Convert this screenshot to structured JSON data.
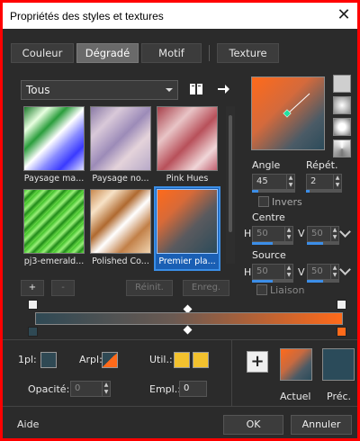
{
  "window": {
    "title": "Propriétés des styles et textures"
  },
  "tabs": [
    {
      "label": "Couleur",
      "active": false
    },
    {
      "label": "Dégradé",
      "active": true
    },
    {
      "label": "Motif",
      "active": false
    },
    {
      "label": "Texture",
      "active": false
    }
  ],
  "filter": {
    "value": "Tous"
  },
  "gradients": [
    {
      "label": "Paysage ma...",
      "selected": false
    },
    {
      "label": "Paysage no...",
      "selected": false
    },
    {
      "label": "Pink Hues",
      "selected": false
    },
    {
      "label": "pj3-emerald...",
      "selected": false
    },
    {
      "label": "Polished Co...",
      "selected": false
    },
    {
      "label": "Premier pla...",
      "selected": true
    }
  ],
  "list_buttons": {
    "add": "+",
    "remove": "-",
    "reset": "Réinit.",
    "save": "Enreg."
  },
  "params": {
    "angle_label": "Angle",
    "angle_value": "45",
    "repeat_label": "Répét.",
    "repeat_value": "2",
    "invert_label": "Invers",
    "center_label": "Centre",
    "center_h_label": "H",
    "center_h": "50",
    "center_v_label": "V",
    "center_v": "50",
    "source_label": "Source",
    "source_h_label": "H",
    "source_h": "50",
    "source_v_label": "V",
    "source_v": "50",
    "link_label": "Liaison"
  },
  "stop_props": {
    "first_label": "1pl:",
    "arpl_label": "Arpl:",
    "util_label": "Util.:",
    "opacity_label": "Opacité:",
    "opacity_value": "0",
    "location_label": "Empl.:",
    "location_value": "0"
  },
  "swatches": {
    "current_label": "Actuel",
    "previous_label": "Préc."
  },
  "footer": {
    "help": "Aide",
    "ok": "OK",
    "cancel": "Annuler"
  },
  "colors": {
    "accent": "#3c8ee8",
    "orange": "#ff6a1a",
    "teal": "#2f4954",
    "yellow": "#f2c12e"
  }
}
